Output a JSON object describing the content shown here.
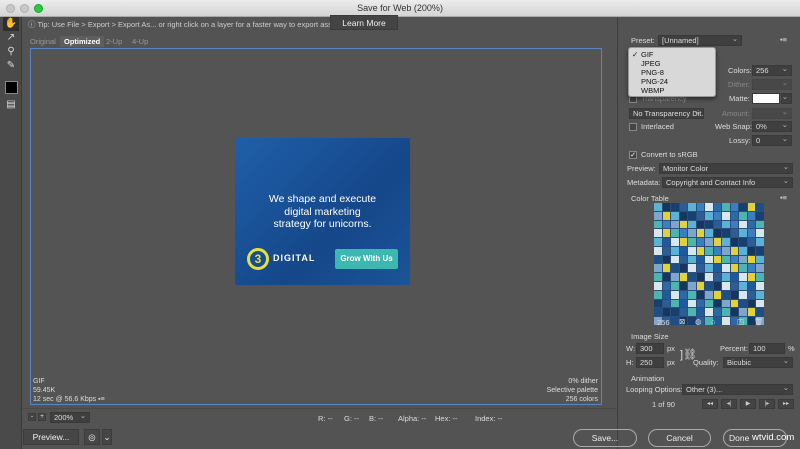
{
  "window": {
    "title": "Save for Web (200%)"
  },
  "tip": {
    "text": "Tip: Use File > Export > Export As...  or right click on a layer for a faster way to export assets",
    "learn_more": "Learn More"
  },
  "tabs": [
    "Original",
    "Optimized",
    "2-Up",
    "4-Up"
  ],
  "ad": {
    "headline": [
      "We shape and execute",
      "digital marketing",
      "strategy for unicorns."
    ],
    "logo_mark": "3",
    "logo_text": "DIGITAL",
    "cta": "Grow With Us"
  },
  "image_info": {
    "format": "GIF",
    "size": "59.45K",
    "download": "12 sec @ 56.6 Kbps",
    "dither": "0% dither",
    "palette": "Selective palette",
    "colors": "256 colors"
  },
  "status": {
    "zoom": "200%",
    "r": "R: --",
    "g": "G: --",
    "b": "B: --",
    "alpha": "Alpha: --",
    "hex": "Hex: --",
    "index": "Index: --"
  },
  "buttons": {
    "preview": "Preview...",
    "save": "Save...",
    "cancel": "Cancel",
    "done": "Done"
  },
  "panel": {
    "preset_label": "Preset:",
    "preset_value": "[Unnamed]",
    "format_options": [
      "GIF",
      "JPEG",
      "PNG-8",
      "PNG-24",
      "WBMP"
    ],
    "format_selected": "GIF",
    "colors_label": "Colors:",
    "colors_value": "256",
    "dither_label": "Dither:",
    "transparency_label": "Transparency",
    "matte_label": "Matte:",
    "transparency_dither": "No Transparency Dit...",
    "amount_label": "Amount:",
    "interlaced_label": "Interlaced",
    "websnap_label": "Web Snap:",
    "websnap_value": "0%",
    "lossy_label": "Lossy:",
    "lossy_value": "0",
    "convert_srgb": "Convert to sRGB",
    "preview_label": "Preview:",
    "preview_value": "Monitor Color",
    "metadata_label": "Metadata:",
    "metadata_value": "Copyright and Contact Info",
    "color_table_title": "Color Table",
    "color_count": "256",
    "palette": [
      "#1d4f86",
      "#2a6aa8",
      "#173f70",
      "#3b7fc0",
      "#5ab3d6",
      "#e3d13a",
      "#d8e6ee",
      "#16365d",
      "#4cb5b0",
      "#2c5d94",
      "#7fa6c9",
      "#1f5a9e"
    ],
    "image_size_title": "Image Size",
    "w_label": "W:",
    "w_value": "300",
    "h_label": "H:",
    "h_value": "250",
    "px": "px",
    "percent_label": "Percent:",
    "percent_value": "100",
    "percent_unit": "%",
    "quality_label": "Quality:",
    "quality_value": "Bicubic",
    "animation_title": "Animation",
    "looping_label": "Looping Options:",
    "looping_value": "Other (3)...",
    "frame": "1 of 90"
  },
  "watermark": "wtvid.com"
}
